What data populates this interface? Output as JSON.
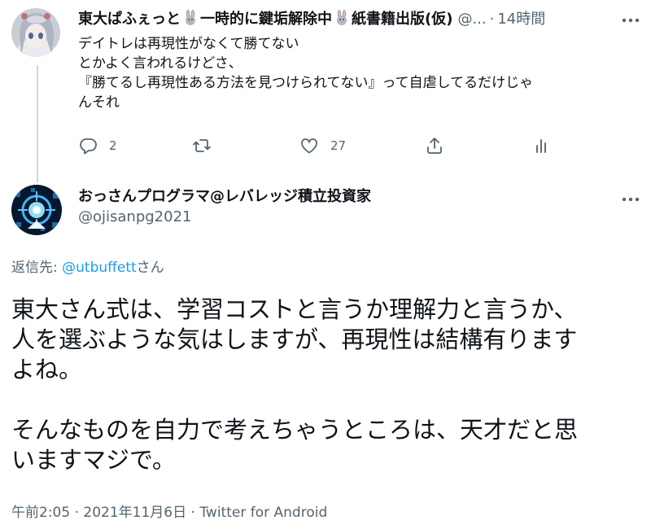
{
  "parent_tweet": {
    "display_name": "東大ぱふぇっと",
    "status_text": "一時的に鍵垢解除中",
    "name_suffix": "紙書籍出版(仮)",
    "handle": "@...",
    "separator": "·",
    "time": "14時間",
    "body_lines": [
      "デイトレは再現性がなくて勝てない",
      "とかよく言われるけどさ、",
      "『勝てるし再現性ある方法を見つけられてない』って自虐してるだけじゃ",
      "んそれ"
    ],
    "actions": {
      "reply_count": "2",
      "retweet_count": "",
      "like_count": "27"
    }
  },
  "main_tweet": {
    "display_name": "おっさんプログラマ@レバレッジ積立投資家",
    "handle": "@ojisanpg2021",
    "replying_prefix": "返信先: ",
    "replying_to": "@utbuffett",
    "replying_suffix": "さん",
    "body_lines": [
      "東大さん式は、学習コストと言うか理解力と言うか、",
      "人を選ぶような気はしますが、再現性は結構有ります",
      "よね。",
      "",
      "そんなものを自力で考えちゃうところは、天才だと思",
      "いますマジで。"
    ],
    "time": "午前2:05",
    "date": "2021年11月6日",
    "separator": " · ",
    "source": "Twitter for Android"
  },
  "icons": [
    "more-icon",
    "reply-icon",
    "retweet-icon",
    "like-icon",
    "share-icon",
    "analytics-icon",
    "rabbit-emoji"
  ],
  "colors": {
    "text": "#0f1419",
    "secondary": "#536471",
    "link": "#1d9bf0",
    "thread_line": "#cfd9de"
  }
}
